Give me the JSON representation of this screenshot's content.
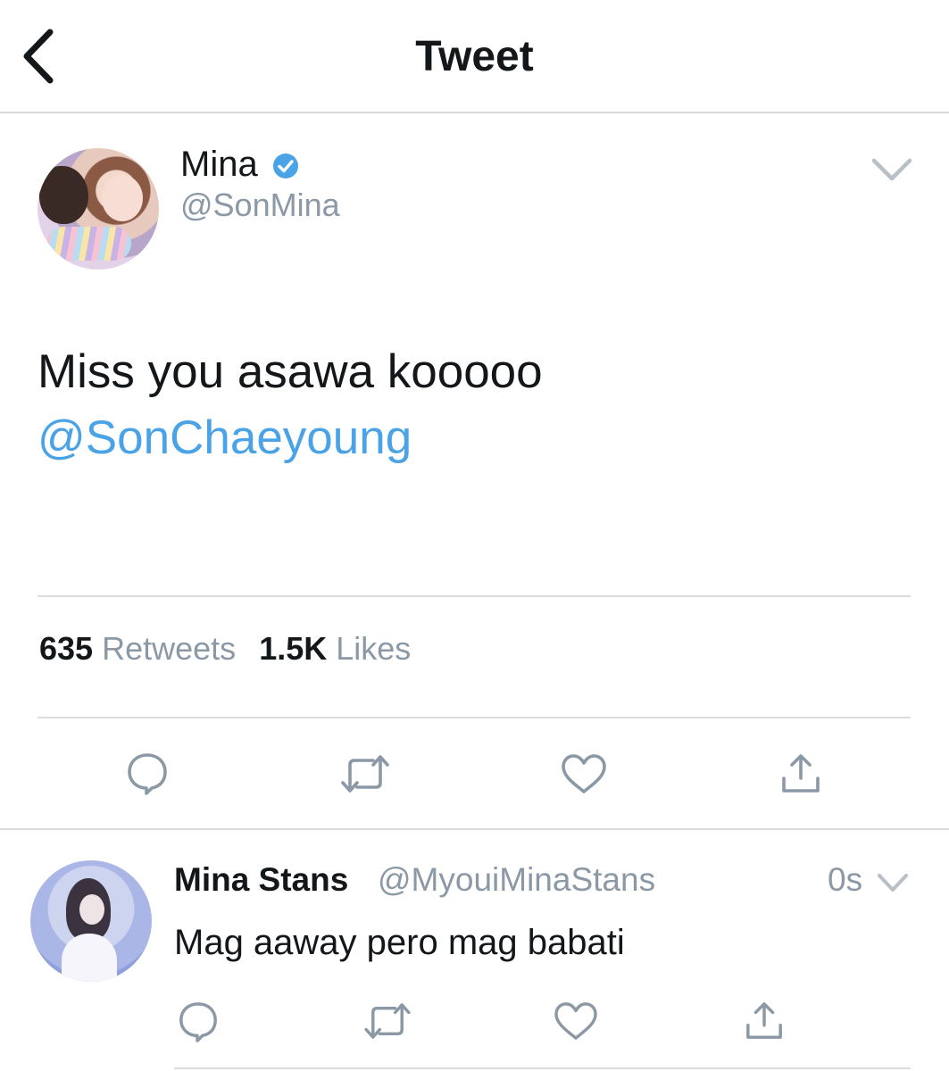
{
  "header": {
    "title": "Tweet",
    "back_icon": "chevron-left-icon"
  },
  "tweet": {
    "author_name": "Mina",
    "verified": true,
    "author_handle": "@SonMina",
    "text": "Miss you asawa kooooo",
    "mention": "@SonChaeyoung",
    "retweet_count": "635",
    "retweet_label": "Retweets",
    "like_count": "1.5K",
    "like_label": "Likes",
    "actions": [
      "reply-icon",
      "retweet-icon",
      "like-icon",
      "share-icon"
    ]
  },
  "reply": {
    "author_name": "Mina Stans",
    "author_handle": "@MyouiMinaStans",
    "time": "0s",
    "text": "Mag aaway pero mag babati",
    "actions": [
      "reply-icon",
      "retweet-icon",
      "like-icon",
      "share-icon"
    ]
  },
  "colors": {
    "accent": "#4ba3e7",
    "icon_gray": "#8b98a5",
    "text": "#14171a",
    "divider": "#dcdcdc"
  }
}
